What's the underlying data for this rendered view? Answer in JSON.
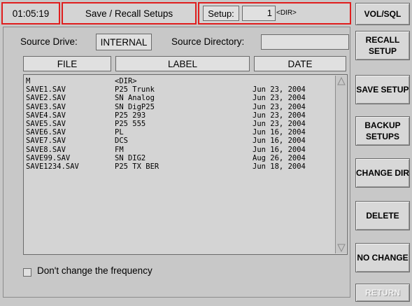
{
  "header": {
    "time": "01:05:19",
    "title": "Save / Recall Setups",
    "setup_label": "Setup:",
    "setup_value": "1",
    "setup_dir": "<DIR>"
  },
  "source": {
    "drive_label": "Source Drive:",
    "drive_value": "INTERNAL",
    "directory_label": "Source Directory:",
    "directory_value": ""
  },
  "table": {
    "columns": [
      "FILE",
      "LABEL",
      "DATE"
    ],
    "rows": [
      {
        "file": "M",
        "label": "<DIR>",
        "date": ""
      },
      {
        "file": "SAVE1.SAV",
        "label": "P25 Trunk",
        "date": "Jun 23, 2004"
      },
      {
        "file": "SAVE2.SAV",
        "label": "SN Analog",
        "date": "Jun 23, 2004"
      },
      {
        "file": "SAVE3.SAV",
        "label": "SN DigP25",
        "date": "Jun 23, 2004"
      },
      {
        "file": "SAVE4.SAV",
        "label": "P25 293",
        "date": "Jun 23, 2004"
      },
      {
        "file": "SAVE5.SAV",
        "label": "P25 555",
        "date": "Jun 23, 2004"
      },
      {
        "file": "SAVE6.SAV",
        "label": "PL",
        "date": "Jun 16, 2004"
      },
      {
        "file": "SAVE7.SAV",
        "label": "DCS",
        "date": "Jun 16, 2004"
      },
      {
        "file": "SAVE8.SAV",
        "label": "FM",
        "date": "Jun 16, 2004"
      },
      {
        "file": "SAVE99.SAV",
        "label": "SN DIG2",
        "date": "Aug 26, 2004"
      },
      {
        "file": "SAVE1234.SAV",
        "label": "P25 TX BER",
        "date": "Jun 18, 2004"
      }
    ]
  },
  "options": {
    "dont_change_frequency_label": "Don't change the frequency",
    "dont_change_frequency_checked": false
  },
  "buttons": {
    "vol_sql": "VOL/SQL",
    "recall_setup": "RECALL SETUP",
    "save_setup": "SAVE SETUP",
    "backup_setups": "BACKUP SETUPS",
    "change_dir": "CHANGE DIR",
    "delete": "DELETE",
    "no_change": "NO CHANGE",
    "return": "RETURN"
  },
  "colors": {
    "highlight_border": "#e01e1e",
    "panel": "#c8c8c8",
    "field": "#e0e0e0"
  },
  "icons": [
    "scroll-up-arrow-icon",
    "scroll-down-arrow-icon"
  ]
}
